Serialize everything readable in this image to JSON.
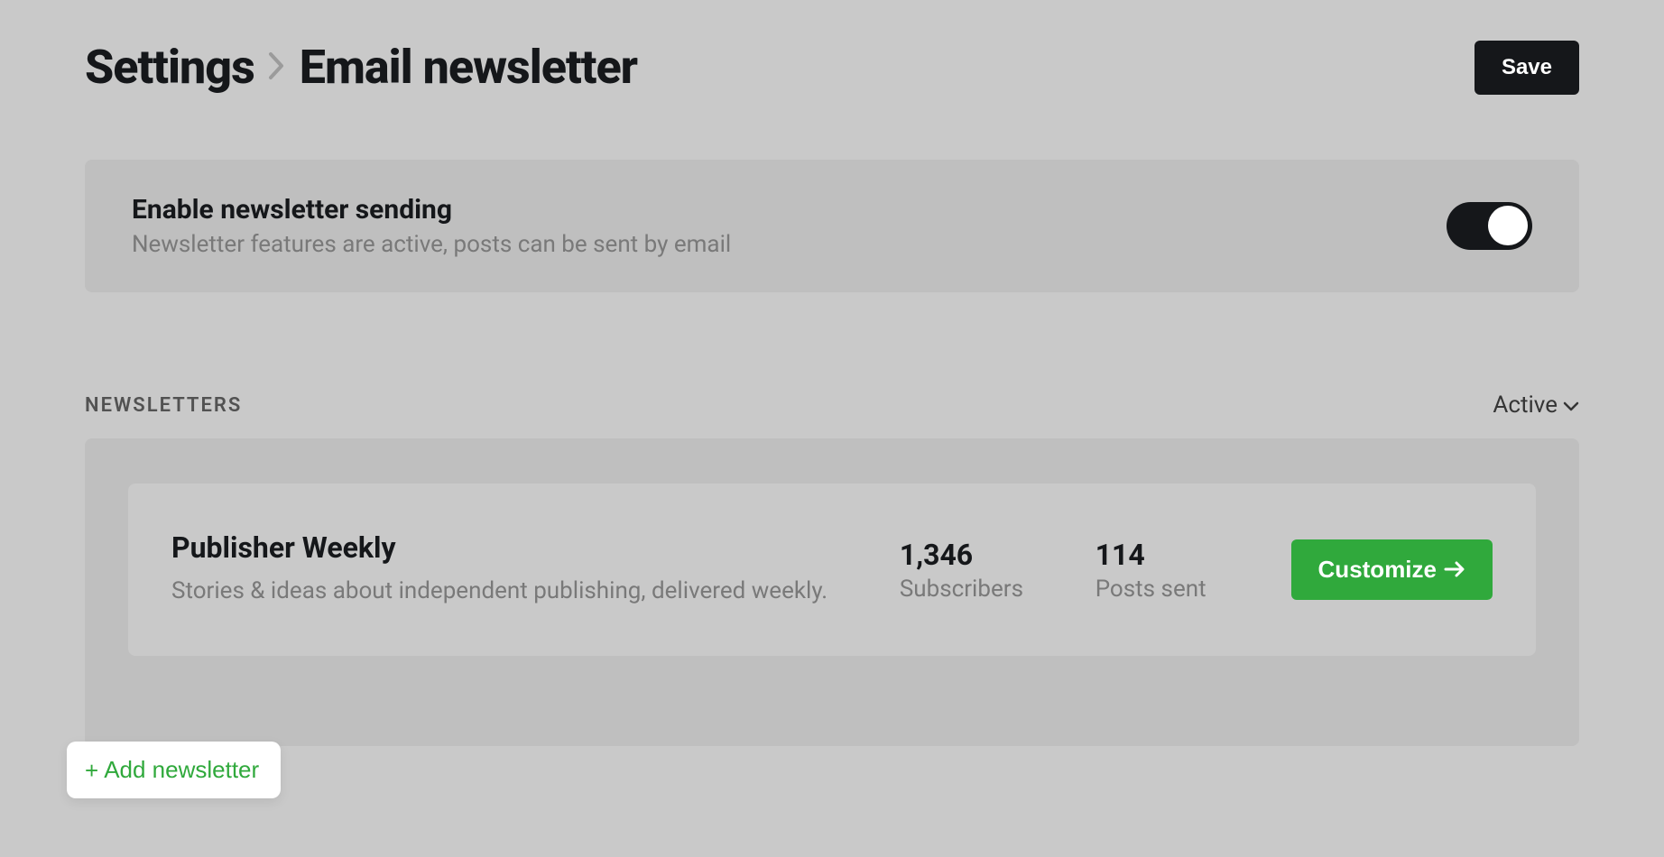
{
  "header": {
    "breadcrumb_parent": "Settings",
    "breadcrumb_current": "Email newsletter",
    "save_label": "Save"
  },
  "enable_card": {
    "title": "Enable newsletter sending",
    "description": "Newsletter features are active, posts can be sent by email",
    "toggled_on": true
  },
  "section": {
    "label": "NEWSLETTERS",
    "filter_label": "Active"
  },
  "newsletters": [
    {
      "name": "Publisher Weekly",
      "description": "Stories & ideas about independent publishing, delivered weekly.",
      "subscribers_value": "1,346",
      "subscribers_label": "Subscribers",
      "posts_value": "114",
      "posts_label": "Posts sent",
      "customize_label": "Customize"
    }
  ],
  "add_button_label": "Add newsletter"
}
